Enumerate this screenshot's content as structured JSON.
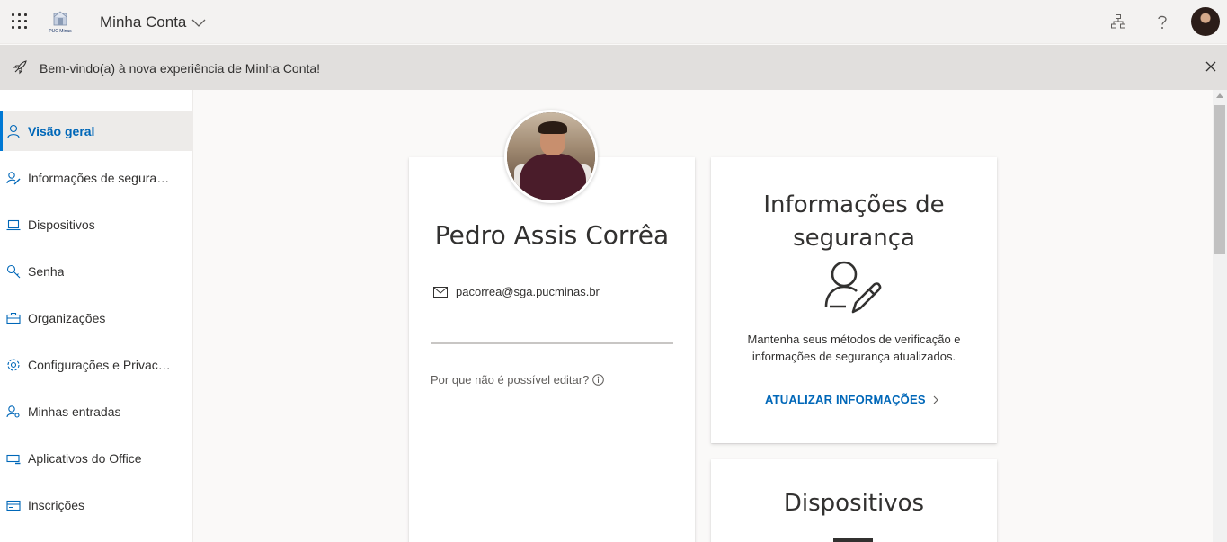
{
  "header": {
    "app_title": "Minha Conta",
    "logo_text": "PUC Minas",
    "icons": [
      "waffle-icon",
      "chevron-down-icon",
      "org-chart-icon",
      "help-icon",
      "avatar"
    ]
  },
  "banner": {
    "message": "Bem-vindo(a) à nova experiência de Minha Conta!",
    "icons": [
      "rocket-icon",
      "close-icon"
    ]
  },
  "sidebar": {
    "items": [
      {
        "label": "Visão geral",
        "icon": "person-icon",
        "active": true
      },
      {
        "label": "Informações de segurança",
        "icon": "person-edit-icon",
        "active": false
      },
      {
        "label": "Dispositivos",
        "icon": "laptop-icon",
        "active": false
      },
      {
        "label": "Senha",
        "icon": "key-icon",
        "active": false
      },
      {
        "label": "Organizações",
        "icon": "briefcase-icon",
        "active": false
      },
      {
        "label": "Configurações e Privacidade",
        "icon": "gear-icon",
        "active": false
      },
      {
        "label": "Minhas entradas",
        "icon": "person-key-icon",
        "active": false
      },
      {
        "label": "Aplicativos do Office",
        "icon": "apps-icon",
        "active": false
      },
      {
        "label": "Inscrições",
        "icon": "card-icon",
        "active": false
      }
    ]
  },
  "profile": {
    "name": "Pedro Assis Corrêa",
    "email": "pacorrea@sga.pucminas.br",
    "why_cant_edit": "Por que não é possível editar?"
  },
  "security_card": {
    "title": "Informações de segurança",
    "description": "Mantenha seus métodos de verificação e informações de segurança atualizados.",
    "link": "ATUALIZAR INFORMAÇÕES"
  },
  "devices_card": {
    "title": "Dispositivos"
  },
  "colors": {
    "accent": "#0067b8",
    "active_border": "#0078d4",
    "header_bg": "#f3f2f1",
    "banner_bg": "#e1dfdd"
  }
}
